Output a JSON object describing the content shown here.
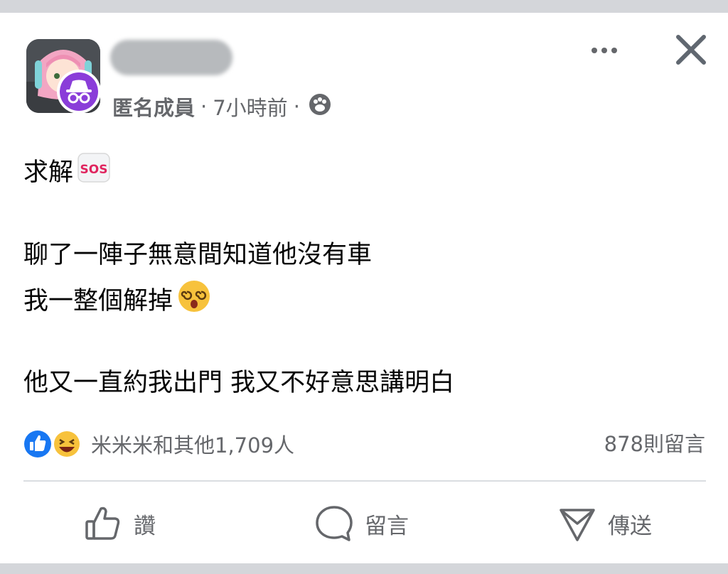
{
  "post": {
    "author_label": "匿名成員",
    "time": "7小時前",
    "privacy_icon": "group-icon",
    "lines": [
      "求解",
      "聊了一陣子無意間知道他沒有車",
      "我一整個解掉",
      "他又一直約我出門 我又不好意思講明白"
    ],
    "emojis": {
      "line1": "sos-emoji",
      "line3": "dizzy-face-emoji"
    }
  },
  "reactions": {
    "icons": [
      "like-icon",
      "haha-icon"
    ],
    "text": "米米米和其他1,709人"
  },
  "comments": {
    "count_text": "878則留言"
  },
  "actions": {
    "like_label": "讚",
    "comment_label": "留言",
    "share_label": "傳送"
  },
  "colors": {
    "like_blue": "#1877f2",
    "anon_purple": "#8a3dd9",
    "secondary_text": "#65676b",
    "sos_red": "#e0245e"
  }
}
